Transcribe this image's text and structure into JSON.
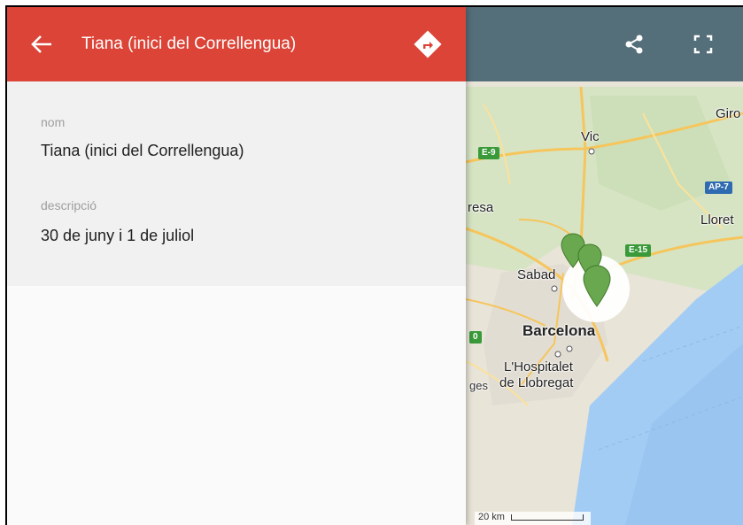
{
  "header": {
    "title": "Tiana (inici del Correllengua)",
    "color": "#db4437"
  },
  "fields": [
    {
      "label": "nom",
      "value": "Tiana (inici del Correllengua)"
    },
    {
      "label": "descripció",
      "value": "30 de juny i 1 de juliol"
    }
  ],
  "map": {
    "toolbar_color": "#546e7a",
    "labels": {
      "vic": "Vic",
      "girona": "Giro",
      "manresa": "resa",
      "lloret": "Lloret",
      "sabadell": "Sabad",
      "barcelona": "Barcelona",
      "hospitalet_1": "L'Hospitalet",
      "hospitalet_2": "de Llobregat",
      "prefix_ges": "ges"
    },
    "road_shields": {
      "e9": "E-9",
      "ap7": "AP-7",
      "e15": "E-15",
      "zero": "0"
    },
    "scale": "20 km",
    "marker_color": "#6aa84f"
  },
  "icons": [
    "back-arrow-icon",
    "directions-icon",
    "share-icon",
    "fullscreen-icon",
    "map-marker-icon"
  ]
}
